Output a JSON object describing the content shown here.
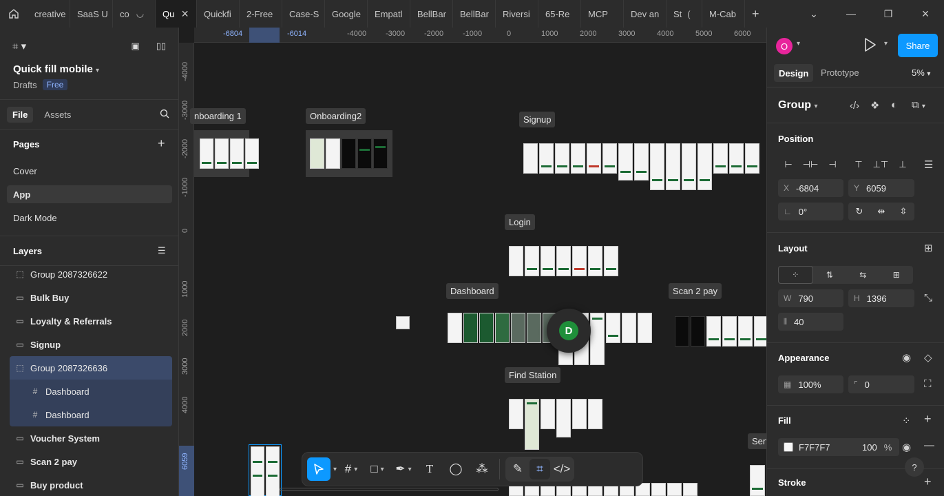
{
  "tabs": [
    {
      "label": "creative"
    },
    {
      "label": "SaaS U"
    },
    {
      "label": "co"
    },
    {
      "label": "Qu",
      "active": true
    },
    {
      "label": "Quickfi"
    },
    {
      "label": "2-Free"
    },
    {
      "label": "Case-S"
    },
    {
      "label": "Google"
    },
    {
      "label": "Empatl"
    },
    {
      "label": "BellBar"
    },
    {
      "label": "BellBar"
    },
    {
      "label": "Riversi"
    },
    {
      "label": "65-Re"
    },
    {
      "label": "MCP"
    },
    {
      "label": "Dev an"
    },
    {
      "label": "St"
    },
    {
      "label": "M-Cab"
    }
  ],
  "file": {
    "title": "Quick fill mobile",
    "location": "Drafts",
    "plan": "Free"
  },
  "left_tabs": {
    "file": "File",
    "assets": "Assets"
  },
  "pages": {
    "heading": "Pages",
    "items": [
      "Cover",
      "App",
      "Dark Mode"
    ],
    "selected": "App"
  },
  "layers": {
    "heading": "Layers",
    "items": [
      {
        "label": "Group 2087326622",
        "type": "group"
      },
      {
        "label": "Bulk Buy",
        "type": "section"
      },
      {
        "label": "Loyalty & Referrals",
        "type": "section"
      },
      {
        "label": "Signup",
        "type": "section"
      },
      {
        "label": "Group 2087326636",
        "type": "group",
        "selected": true
      },
      {
        "label": "Dashboard",
        "type": "frame",
        "child": true
      },
      {
        "label": "Dashboard",
        "type": "frame",
        "child": true
      },
      {
        "label": "Voucher System",
        "type": "section"
      },
      {
        "label": "Scan 2 pay",
        "type": "section"
      },
      {
        "label": "Buy product",
        "type": "section"
      }
    ]
  },
  "ruler": {
    "top": [
      "-6804",
      "-6014",
      "-4000",
      "-3000",
      "-2000",
      "-1000",
      "0",
      "1000",
      "2000",
      "3000",
      "4000",
      "5000",
      "6000"
    ],
    "left": [
      "-4000",
      "-3000",
      "-2000",
      "-1000",
      "0",
      "1000",
      "2000",
      "3000",
      "4000",
      "6059"
    ]
  },
  "canvas": {
    "frames": {
      "onboarding1": "nboarding 1",
      "onboarding2": "Onboarding2",
      "signup": "Signup",
      "login": "Login",
      "dashboard": "Dashboard",
      "scan2pay": "Scan 2 pay",
      "find_station": "Find Station",
      "send": "Sen"
    },
    "collaborator": "D"
  },
  "toolbar": {
    "tools": [
      "move-tool",
      "frame-tool",
      "shape-tool",
      "pen-tool",
      "text-tool",
      "comment-tool",
      "actions-tool",
      "draw-mode",
      "design-mode",
      "dev-mode"
    ]
  },
  "right": {
    "user_initial": "O",
    "share": "Share",
    "tabs": {
      "design": "Design",
      "prototype": "Prototype"
    },
    "zoom": "5%",
    "selection": "Group",
    "position": {
      "heading": "Position",
      "x_label": "X",
      "x": "-6804",
      "y_label": "Y",
      "y": "6059",
      "rotation": "0°"
    },
    "layout": {
      "heading": "Layout",
      "w_label": "W",
      "w": "790",
      "h_label": "H",
      "h": "1396",
      "gap": "40"
    },
    "appearance": {
      "heading": "Appearance",
      "opacity": "100%",
      "radius": "0"
    },
    "fill": {
      "heading": "Fill",
      "color": "F7F7F7",
      "opacity": "100",
      "unit": "%"
    },
    "stroke": {
      "heading": "Stroke"
    },
    "help": "?"
  }
}
